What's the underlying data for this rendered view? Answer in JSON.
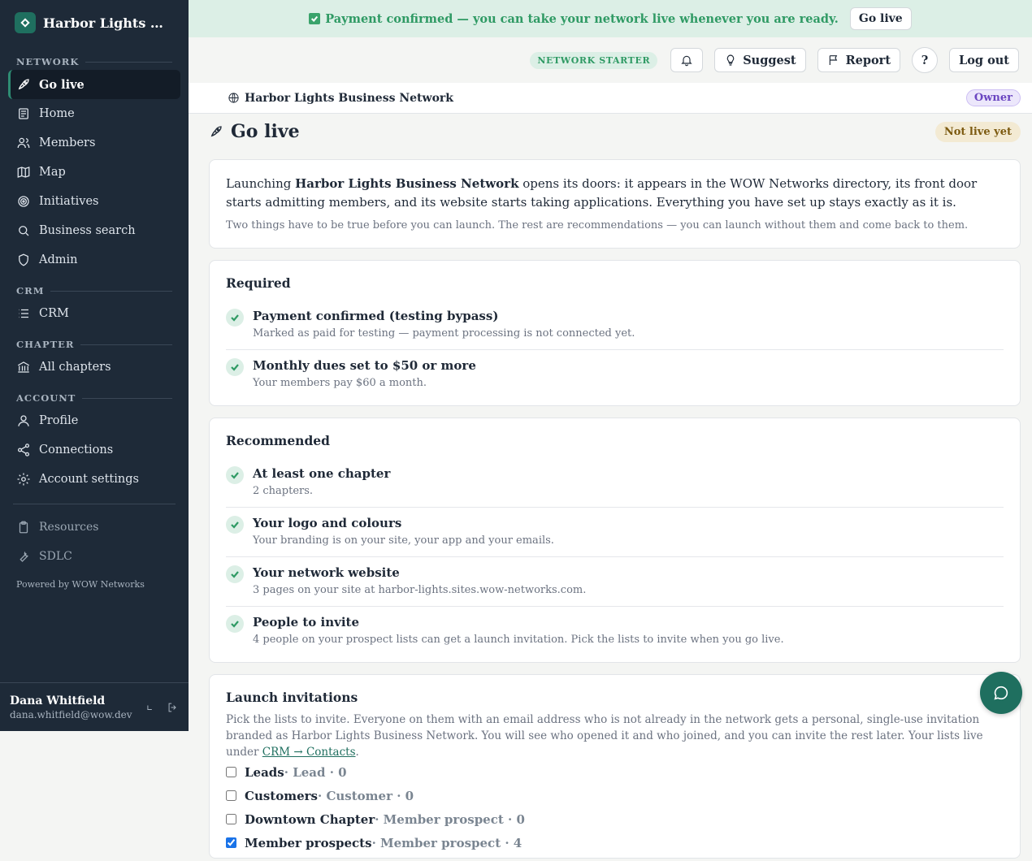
{
  "brand": {
    "name": "Harbor Lights Busi..."
  },
  "sidebar": {
    "sections": [
      {
        "title": "NETWORK",
        "items": [
          {
            "label": "Go live",
            "icon": "rocket-icon",
            "active": true
          },
          {
            "label": "Home",
            "icon": "newspaper-icon"
          },
          {
            "label": "Members",
            "icon": "users-icon"
          },
          {
            "label": "Map",
            "icon": "map-icon"
          },
          {
            "label": "Initiatives",
            "icon": "target-icon"
          },
          {
            "label": "Business search",
            "icon": "search-icon"
          },
          {
            "label": "Admin",
            "icon": "shield-icon"
          }
        ]
      },
      {
        "title": "CRM",
        "items": [
          {
            "label": "CRM",
            "icon": "list-icon"
          }
        ]
      },
      {
        "title": "CHAPTER",
        "items": [
          {
            "label": "All chapters",
            "icon": "bank-icon"
          }
        ]
      },
      {
        "title": "ACCOUNT",
        "items": [
          {
            "label": "Profile",
            "icon": "user-icon"
          },
          {
            "label": "Connections",
            "icon": "share-icon"
          },
          {
            "label": "Account settings",
            "icon": "gear-icon"
          }
        ]
      }
    ],
    "extra": [
      {
        "label": "Resources",
        "icon": "clipboard-icon"
      },
      {
        "label": "SDLC",
        "icon": "wrench-icon"
      }
    ],
    "powered_by": "Powered by WOW Networks",
    "user": {
      "name": "Dana Whitfield",
      "email": "dana.whitfield@wow.dev"
    }
  },
  "banner": {
    "text": "Payment confirmed — you can take your network live whenever you are ready.",
    "button": "Go live"
  },
  "topbar": {
    "plan": "NETWORK STARTER",
    "suggest": "Suggest",
    "report": "Report",
    "help": "?",
    "logout": "Log out"
  },
  "netbar": {
    "name": "Harbor Lights Business Network",
    "role": "Owner"
  },
  "page": {
    "title": "Go live",
    "status": "Not live yet"
  },
  "intro": {
    "pre": "Launching ",
    "network": "Harbor Lights Business Network",
    "post": " opens its doors: it appears in the WOW Networks directory, its front door starts admitting members, and its website starts taking applications. Everything you have set up stays exactly as it is.",
    "sub": "Two things have to be true before you can launch. The rest are recommendations — you can launch without them and come back to them."
  },
  "required": {
    "title": "Required",
    "items": [
      {
        "title": "Payment confirmed (testing bypass)",
        "desc": "Marked as paid for testing — payment processing is not connected yet."
      },
      {
        "title": "Monthly dues set to $50 or more",
        "desc": "Your members pay $60 a month."
      }
    ]
  },
  "recommended": {
    "title": "Recommended",
    "items": [
      {
        "title": "At least one chapter",
        "desc": "2 chapters."
      },
      {
        "title": "Your logo and colours",
        "desc": "Your branding is on your site, your app and your emails."
      },
      {
        "title": "Your network website",
        "desc": "3 pages on your site at harbor-lights.sites.wow-networks.com."
      },
      {
        "title": "People to invite",
        "desc": "4 people on your prospect lists can get a launch invitation. Pick the lists to invite when you go live."
      }
    ]
  },
  "invitations": {
    "title": "Launch invitations",
    "desc": "Pick the lists to invite. Everyone on them with an email address who is not already in the network gets a personal, single-use invitation branded as Harbor Lights Business Network. You will see who opened it and who joined, and you can invite the rest later. Your lists live under ",
    "link": "CRM → Contacts",
    "desc_end": ".",
    "lists": [
      {
        "name": "Leads",
        "meta": " · Lead · 0",
        "checked": false
      },
      {
        "name": "Customers",
        "meta": " · Customer · 0",
        "checked": false
      },
      {
        "name": "Downtown Chapter",
        "meta": " · Member prospect · 0",
        "checked": false
      },
      {
        "name": "Member prospects",
        "meta": " · Member prospect · 4",
        "checked": true
      }
    ]
  },
  "colors": {
    "sidebar": "#1e2a38",
    "accent": "#1f6f5f",
    "success": "#2f9a64",
    "banner_bg": "#dcefe6"
  }
}
